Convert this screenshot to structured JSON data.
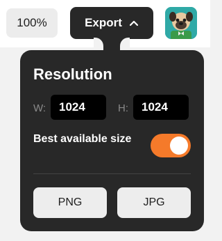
{
  "toolbar": {
    "zoom_label": "100%",
    "export_label": "Export",
    "export_icon": "chevron-up-icon",
    "avatar_icon": "pug-avatar"
  },
  "export_panel": {
    "title": "Resolution",
    "width_label": "W:",
    "width_value": "1024",
    "height_label": "H:",
    "height_value": "1024",
    "best_size_label": "Best available size",
    "best_size_enabled": true,
    "formats": [
      "PNG",
      "JPG"
    ]
  },
  "colors": {
    "accent": "#f57a2a",
    "panel": "#282828"
  }
}
